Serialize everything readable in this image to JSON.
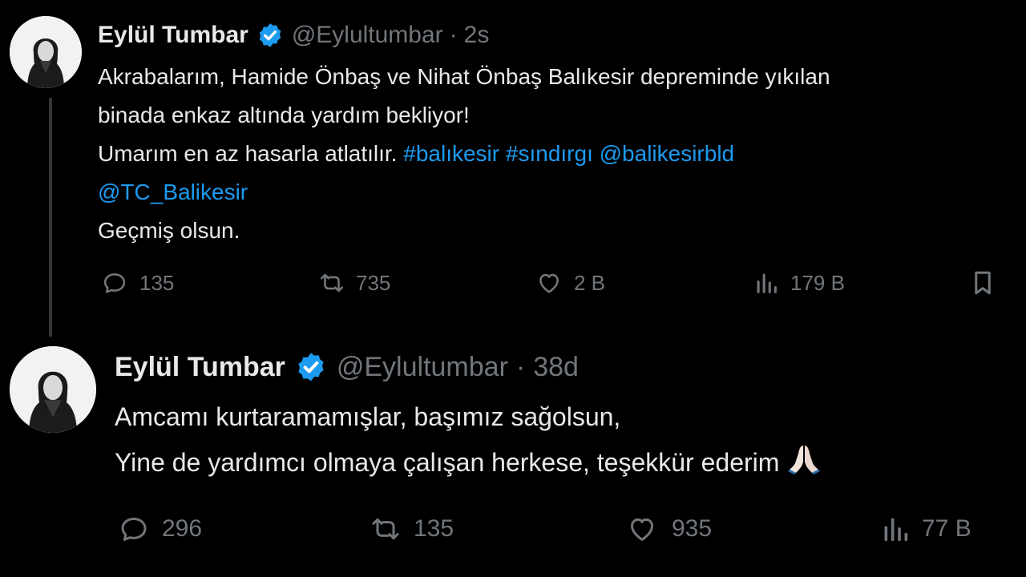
{
  "tweets": [
    {
      "author_name": "Eylül Tumbar",
      "handle": "@Eylultumbar",
      "separator": "·",
      "time": "2s",
      "text": {
        "line1": "Akrabalarım, Hamide Önbaş ve Nihat Önbaş Balıkesir depreminde yıkılan",
        "line2": "binada enkaz altında yardım bekliyor!",
        "line3_prefix": "Umarım en az hasarla atlatılır.",
        "hashtag1": "#balıkesir",
        "hashtag2": "#sındırgı",
        "mention1": "@balikesirbld",
        "mention2": "@TC_Balikesir",
        "line5": "Geçmiş olsun."
      },
      "replies": "135",
      "reposts": "735",
      "likes": "2 B",
      "views": "179 B"
    },
    {
      "author_name": "Eylül Tumbar",
      "handle": "@Eylultumbar",
      "separator": "·",
      "time": "38d",
      "text": {
        "line1": "Amcamı kurtaramamışlar, başımız sağolsun,",
        "line2": "Yine de yardımcı olmaya çalışan herkese, teşekkür ederim"
      },
      "emoji_icon": "folded-hands-icon",
      "replies": "296",
      "reposts": "135",
      "likes": "935",
      "views": "77 B"
    }
  ],
  "colors": {
    "background": "#000000",
    "text": "#e7e9ea",
    "muted": "#71767b",
    "link": "#1d9bf0",
    "verified": "#1d9bf0"
  }
}
